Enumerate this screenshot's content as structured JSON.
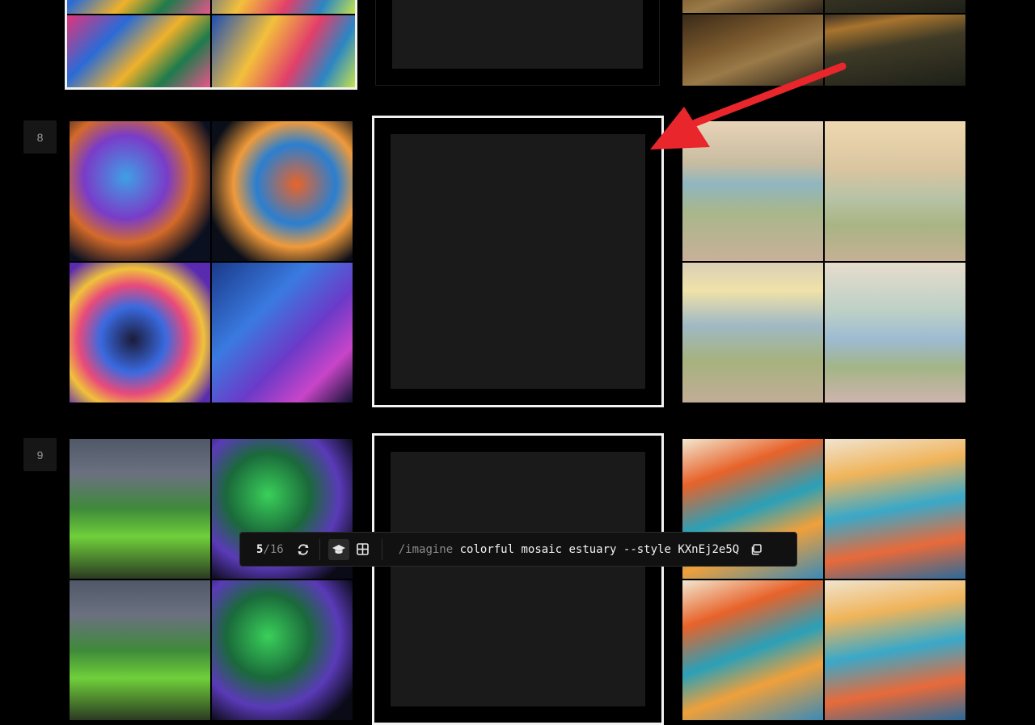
{
  "rows": [
    {
      "number": "8"
    },
    {
      "number": "9"
    }
  ],
  "toolbar": {
    "current": "5",
    "separator": "/",
    "total": "16",
    "prompt_command": "/imagine",
    "prompt_text": "colorful mosaic estuary --style KXnEj2e5Q"
  },
  "icons": {
    "refresh": "refresh-icon",
    "graduation": "graduation-cap-icon",
    "grid": "grid-icon",
    "copy": "copy-icon",
    "arrow": "red-arrow-annotation"
  },
  "colors": {
    "selection_border": "#f2f2f2",
    "arrow": "#e8262b",
    "placeholder": "#1a1a1a"
  }
}
